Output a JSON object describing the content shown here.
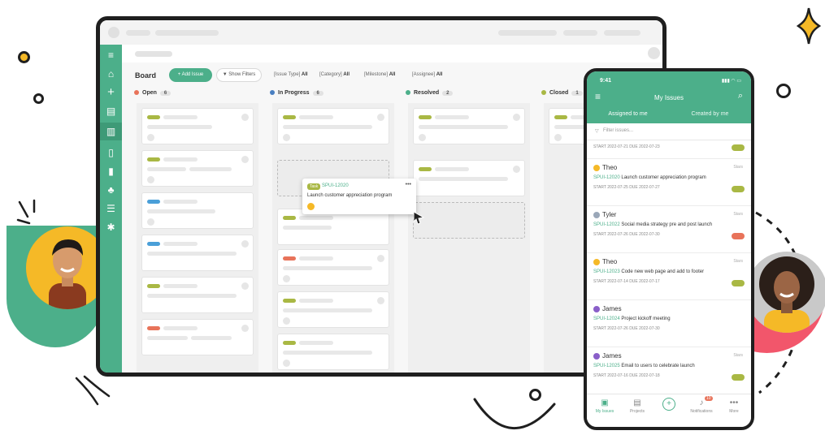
{
  "board": {
    "title": "Board",
    "add_issue": "+ Add Issue",
    "show_filters": "Show Filters",
    "filters": [
      {
        "label": "[Issue Type]",
        "value": "All"
      },
      {
        "label": "[Category]",
        "value": "All"
      },
      {
        "label": "[Milestone]",
        "value": "All"
      },
      {
        "label": "[Assignee]",
        "value": "All"
      }
    ],
    "columns": [
      {
        "name": "Open",
        "count": "6",
        "color": "#e8735a"
      },
      {
        "name": "In Progress",
        "count": "6",
        "color": "#4a7fc1"
      },
      {
        "name": "Resolved",
        "count": "2",
        "color": "#4caf8a"
      },
      {
        "name": "Closed",
        "count": "1",
        "color": "#a9b844"
      }
    ],
    "dragged_card": {
      "type": "Task",
      "key": "SPUI-12020",
      "title": "Launch customer appreciation program",
      "menu": "•••"
    }
  },
  "phone": {
    "time": "9:41",
    "title": "My Issues",
    "tabs": [
      "Assigned to me",
      "Created by me"
    ],
    "filter_placeholder": "Filter issues...",
    "first_dates": "START 2022-07-21   DUE 2022-07-23",
    "issues": [
      {
        "user": "Theo",
        "key": "SPUI-12020",
        "title": "Launch customer appreciation program",
        "dates": "START 2022-07-25   DUE 2022-07-27",
        "tag": "#a9b844",
        "star": "Stars"
      },
      {
        "user": "Tyler",
        "key": "SPUI-12022",
        "title": "Social media strategy pre and post launch",
        "dates": "START 2022-07-26   DUE 2022-07-30",
        "tag": "#e8735a",
        "star": "Stars"
      },
      {
        "user": "Theo",
        "key": "SPUI-12023",
        "title": "Code new web page and add to footer",
        "dates": "START 2022-07-14   DUE 2022-07-17",
        "tag": "#a9b844",
        "star": "Stars"
      },
      {
        "user": "James",
        "key": "SPUI-12024",
        "title": "Project kickoff meeting",
        "dates": "START 2022-07-26   DUE 2022-07-30",
        "tag": "",
        "star": ""
      },
      {
        "user": "James",
        "key": "SPUI-12025",
        "title": "Email to users to celebrate launch",
        "dates": "START 2022-07-16   DUE 2022-07-18",
        "tag": "#a9b844",
        "star": "Stars"
      }
    ],
    "nav": [
      {
        "label": "My Issues",
        "icon": "clipboard-icon"
      },
      {
        "label": "Projects",
        "icon": "projects-icon"
      },
      {
        "label": "",
        "icon": "add-icon"
      },
      {
        "label": "Notifications",
        "icon": "bell-icon",
        "badge": "10"
      },
      {
        "label": "More",
        "icon": "more-icon"
      }
    ]
  },
  "colors": {
    "accent": "#4caf8a",
    "yellow": "#f5b927",
    "coral": "#f2566b"
  }
}
